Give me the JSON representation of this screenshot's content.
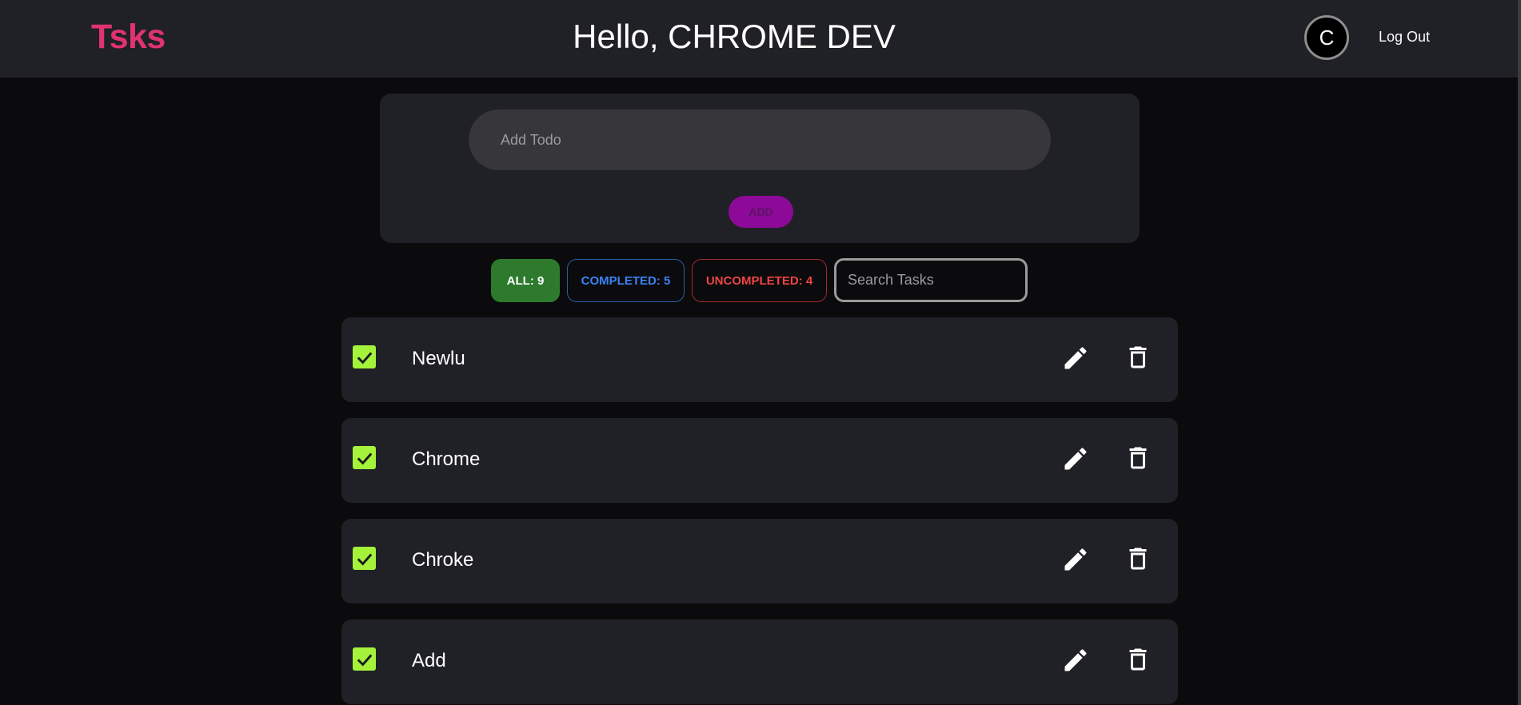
{
  "header": {
    "brand": "Tsks",
    "greeting": "Hello, CHROME DEV",
    "avatar_initial": "C",
    "logout_label": "Log Out"
  },
  "add_todo": {
    "placeholder": "Add Todo",
    "value": "",
    "add_label": "ADD",
    "add_color": "#8c0a97"
  },
  "filters": {
    "all_label": "ALL: 9",
    "completed_label": "COMPLETED: 5",
    "uncompleted_label": "UNCOMPLETED: 4",
    "search_placeholder": "Search Tasks",
    "search_value": ""
  },
  "tasks": [
    {
      "label": "Newlu",
      "completed": true
    },
    {
      "label": "Chrome",
      "completed": true
    },
    {
      "label": "Chroke",
      "completed": true
    },
    {
      "label": "Add",
      "completed": true
    }
  ],
  "colors": {
    "brand": "#e0336f",
    "checkbox": "#a4f33a",
    "all_filter": "#2d7a2d",
    "completed_filter": "#3b82f6",
    "uncompleted_filter": "#ef4444"
  },
  "icons": {
    "checkbox": "check-icon",
    "edit": "pencil-icon",
    "delete": "trash-icon"
  }
}
